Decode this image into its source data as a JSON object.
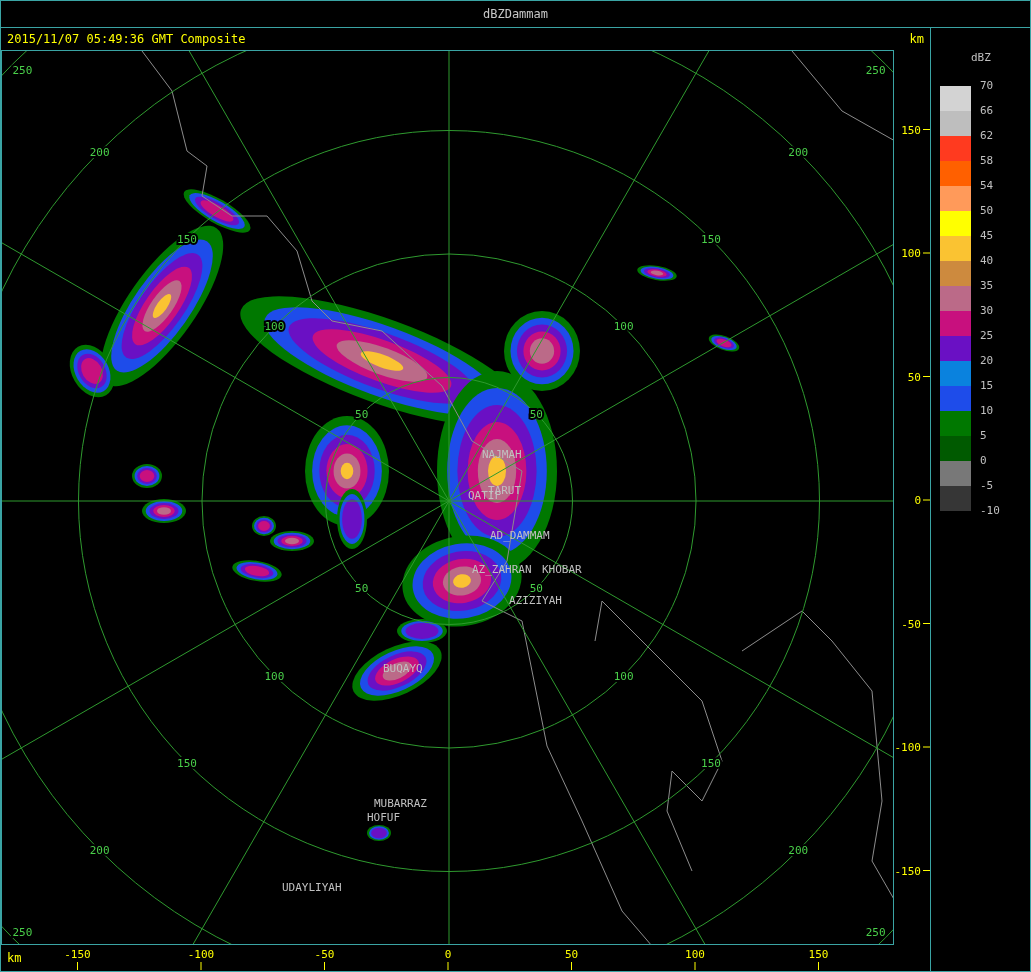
{
  "window": {
    "title": "dBZDammam"
  },
  "header": {
    "timestamp": "2015/11/07 05:49:36 GMT Composite",
    "unit": "km"
  },
  "radar": {
    "ring_labels": [
      {
        "text": "250"
      },
      {
        "text": "250"
      },
      {
        "text": "250"
      },
      {
        "text": "250"
      },
      {
        "text": "200"
      },
      {
        "text": "200"
      },
      {
        "text": "200"
      },
      {
        "text": "200"
      },
      {
        "text": "150"
      },
      {
        "text": "150"
      },
      {
        "text": "150"
      },
      {
        "text": "150"
      },
      {
        "text": "100"
      },
      {
        "text": "100"
      },
      {
        "text": "100"
      },
      {
        "text": "100"
      },
      {
        "text": "50"
      },
      {
        "text": "50"
      },
      {
        "text": "50"
      },
      {
        "text": "50"
      }
    ],
    "cities": [
      {
        "name": "NAJMAH"
      },
      {
        "name": "TARUT"
      },
      {
        "name": "QATIF"
      },
      {
        "name": "AD_DAMMAM"
      },
      {
        "name": "AZ_ZAHRAN"
      },
      {
        "name": "KHOBAR"
      },
      {
        "name": "AZIZIYAH"
      },
      {
        "name": "BUQAYQ"
      },
      {
        "name": "MUBARRAZ"
      },
      {
        "name": "HOFUF"
      },
      {
        "name": "UDAYLIYAH"
      }
    ]
  },
  "y_axis": {
    "ticks": [
      "150",
      "100",
      "50",
      "0",
      "-50",
      "-100",
      "-150"
    ]
  },
  "x_axis": {
    "unit": "km",
    "ticks": [
      "-150",
      "-100",
      "-50",
      "0",
      "50",
      "100",
      "150"
    ]
  },
  "legend": {
    "title": "dBZ",
    "bins": [
      {
        "color": "#d3d3d3"
      },
      {
        "color": "#bebebe"
      },
      {
        "color": "#ff3a1f"
      },
      {
        "color": "#ff6000"
      },
      {
        "color": "#ff9a5a"
      },
      {
        "color": "#ffff00"
      },
      {
        "color": "#fac332"
      },
      {
        "color": "#cd8a3e"
      },
      {
        "color": "#bb6a88"
      },
      {
        "color": "#c8107e"
      },
      {
        "color": "#6a10c4"
      },
      {
        "color": "#0a82de"
      },
      {
        "color": "#1e4cea"
      },
      {
        "color": "#007800"
      },
      {
        "color": "#005a00"
      },
      {
        "color": "#787878"
      },
      {
        "color": "#363636"
      }
    ],
    "ticks": [
      "70",
      "66",
      "62",
      "58",
      "54",
      "50",
      "45",
      "40",
      "35",
      "30",
      "25",
      "20",
      "15",
      "10",
      "5",
      "0",
      "-5",
      "-10"
    ]
  }
}
